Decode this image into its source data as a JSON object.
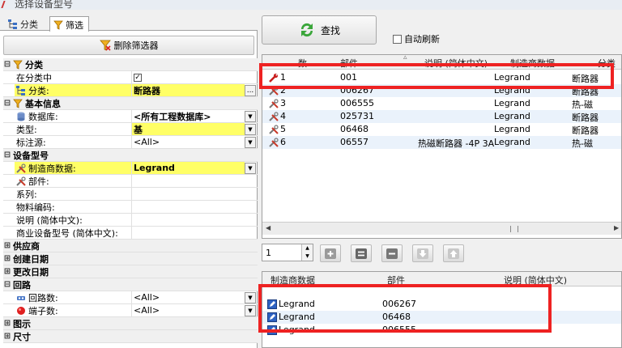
{
  "window": {
    "title": "选择设备型号"
  },
  "tabs": [
    {
      "label": "分类",
      "icon": "tree-icon",
      "active": false
    },
    {
      "label": "筛选",
      "icon": "filter-icon",
      "active": true
    }
  ],
  "filter": {
    "delete_button": "删除筛选器",
    "rows": [
      {
        "type": "category",
        "expander": "⊟",
        "label": "分类",
        "icon": "filter-icon"
      },
      {
        "type": "prop",
        "label": "在分类中",
        "value": "☑",
        "checkbox": true
      },
      {
        "type": "prop",
        "label": "分类:",
        "value": "断路器",
        "bold": true,
        "highlight": true,
        "icon": "tree-icon",
        "ellipsis": "..."
      },
      {
        "type": "category",
        "expander": "⊟",
        "label": "基本信息",
        "icon": "filter-icon"
      },
      {
        "type": "prop",
        "label": "数据库:",
        "value": "<所有工程数据库>",
        "bold": true,
        "icon": "database-icon",
        "dropdown": true
      },
      {
        "type": "prop",
        "label": "类型:",
        "value": "基",
        "bold": true,
        "highlight_value": true,
        "dropdown": true
      },
      {
        "type": "prop",
        "label": "标注源:",
        "value": "<All>",
        "dropdown": true
      },
      {
        "type": "category",
        "expander": "⊟",
        "label": "设备型号"
      },
      {
        "type": "prop",
        "label": "制造商数据:",
        "value": "Legrand",
        "bold": true,
        "highlight": true,
        "icon": "tools-icon",
        "dropdown": true
      },
      {
        "type": "prop",
        "label": "部件:",
        "value": "",
        "icon": "tools-icon"
      },
      {
        "type": "prop",
        "label": "系列:",
        "value": ""
      },
      {
        "type": "prop",
        "label": "物料编码:",
        "value": ""
      },
      {
        "type": "prop",
        "label": "说明 (简体中文):",
        "value": ""
      },
      {
        "type": "prop",
        "label": "商业设备型号 (简体中文):",
        "value": ""
      },
      {
        "type": "category",
        "expander": "⊞",
        "label": "供应商"
      },
      {
        "type": "category",
        "expander": "⊞",
        "label": "创建日期"
      },
      {
        "type": "category",
        "expander": "⊞",
        "label": "更改日期"
      },
      {
        "type": "category",
        "expander": "⊟",
        "label": "回路"
      },
      {
        "type": "prop",
        "label": "回路数:",
        "value": "<All>",
        "icon": "circuit-icon",
        "dropdown": true
      },
      {
        "type": "prop",
        "label": "端子数:",
        "value": "<All>",
        "icon": "terminal-icon",
        "dropdown": true
      },
      {
        "type": "category",
        "expander": "⊞",
        "label": "图示"
      },
      {
        "type": "category",
        "expander": "⊞",
        "label": "尺寸"
      }
    ]
  },
  "search": {
    "find_button": "查找",
    "auto_refresh": "自动刷新"
  },
  "results": {
    "columns": [
      "数",
      "部件",
      "说明 (简体中文)",
      "制造商数据",
      "分类"
    ],
    "rows": [
      {
        "num": "1",
        "part": "001",
        "desc": "",
        "mfr": "Legrand",
        "cat": "断路器",
        "icon": "wrench-red-icon"
      },
      {
        "num": "2",
        "part": "006267",
        "desc": "",
        "mfr": "Legrand",
        "cat": "断路器",
        "icon": "tools-icon"
      },
      {
        "num": "3",
        "part": "006555",
        "desc": "",
        "mfr": "Legrand",
        "cat": "热-磁",
        "icon": "tools-icon"
      },
      {
        "num": "4",
        "part": "025731",
        "desc": "",
        "mfr": "Legrand",
        "cat": "断路器",
        "icon": "tools-icon"
      },
      {
        "num": "5",
        "part": "06468",
        "desc": "",
        "mfr": "Legrand",
        "cat": "断路器",
        "icon": "tools-icon"
      },
      {
        "num": "6",
        "part": "06557",
        "desc": "热磁断路器 -4P 3A",
        "mfr": "Legrand",
        "cat": "热-磁",
        "icon": "tools-icon"
      }
    ],
    "scroll_left": "◀",
    "scroll_right": "▶"
  },
  "quantity": {
    "value": "1"
  },
  "selected": {
    "columns": [
      "制造商数据",
      "部件",
      "说明 (简体中文)"
    ],
    "rows": [
      {
        "mfr": "Legrand",
        "part": "006267"
      },
      {
        "mfr": "Legrand",
        "part": "06468"
      },
      {
        "mfr": "Legrand",
        "part": "006555"
      }
    ]
  },
  "colors": {
    "highlight": "#ffff66",
    "annotation": "#ee2222",
    "alt_row": "#eaf2fb"
  }
}
